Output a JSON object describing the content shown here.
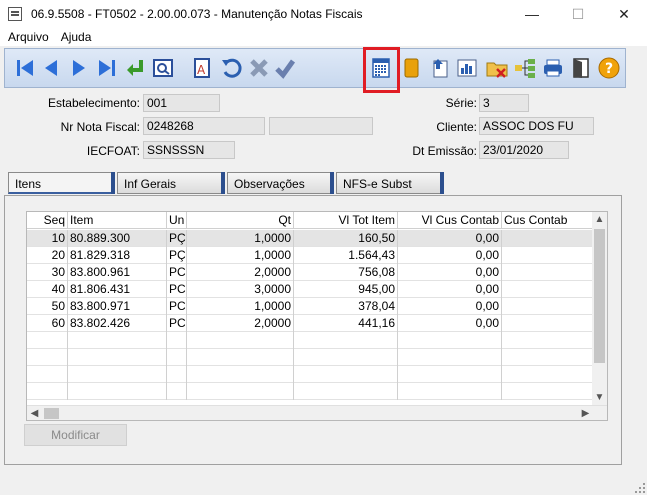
{
  "window": {
    "title": "06.9.5508 - FT0502 - 2.00.00.073 - Manutenção Notas Fiscais",
    "minimize": "—",
    "maximize": "☐",
    "close": "✕"
  },
  "menu": {
    "items": [
      "Arquivo",
      "Ajuda"
    ]
  },
  "toolbar": {
    "buttons": [
      "first-icon",
      "prev-icon",
      "next-icon",
      "last-icon",
      "goto-icon",
      "zoom-icon",
      "edit-icon",
      "undo-icon",
      "delete-icon",
      "confirm-icon",
      "calendar-icon",
      "book-icon",
      "import-icon",
      "chart-icon",
      "folder-x-icon",
      "tree-icon",
      "print-icon",
      "exit-icon",
      "help-icon"
    ]
  },
  "header": {
    "estabelecimento_label": "Estabelecimento:",
    "estabelecimento_value": "001",
    "serie_label": "Série:",
    "serie_value": "3",
    "nota_label": "Nr Nota Fiscal:",
    "nota_value": "0248268",
    "nota_extra1": "",
    "nota_extra2": "",
    "cliente_label": "Cliente:",
    "cliente_value": "ASSOC DOS FU",
    "iecfoat_label": "IECFOAT:",
    "iecfoat_value": "SSNSSSN",
    "emissao_label": "Dt Emissão:",
    "emissao_value": "23/01/2020"
  },
  "tabs": [
    {
      "label": "Itens",
      "active": true
    },
    {
      "label": "Inf  Gerais",
      "active": false
    },
    {
      "label": "Observações",
      "active": false
    },
    {
      "label": "NFS-e Subst",
      "active": false
    }
  ],
  "grid": {
    "columns": [
      "Seq",
      "Item",
      "Un",
      "Qt",
      "Vl Tot Item",
      "Vl Cus Contab",
      "Cus Contab"
    ],
    "rows": [
      [
        "10",
        "80.889.300",
        "PÇ",
        "1,0000",
        "160,50",
        "0,00",
        ""
      ],
      [
        "20",
        "81.829.318",
        "PÇ",
        "1,0000",
        "1.564,43",
        "0,00",
        ""
      ],
      [
        "30",
        "83.800.961",
        "PC",
        "2,0000",
        "756,08",
        "0,00",
        ""
      ],
      [
        "40",
        "81.806.431",
        "PC",
        "3,0000",
        "945,00",
        "0,00",
        ""
      ],
      [
        "50",
        "83.800.971",
        "PC",
        "1,0000",
        "378,04",
        "0,00",
        ""
      ],
      [
        "60",
        "83.802.426",
        "PC",
        "2,0000",
        "441,16",
        "0,00",
        ""
      ]
    ]
  },
  "buttons": {
    "modificar": "Modificar"
  }
}
